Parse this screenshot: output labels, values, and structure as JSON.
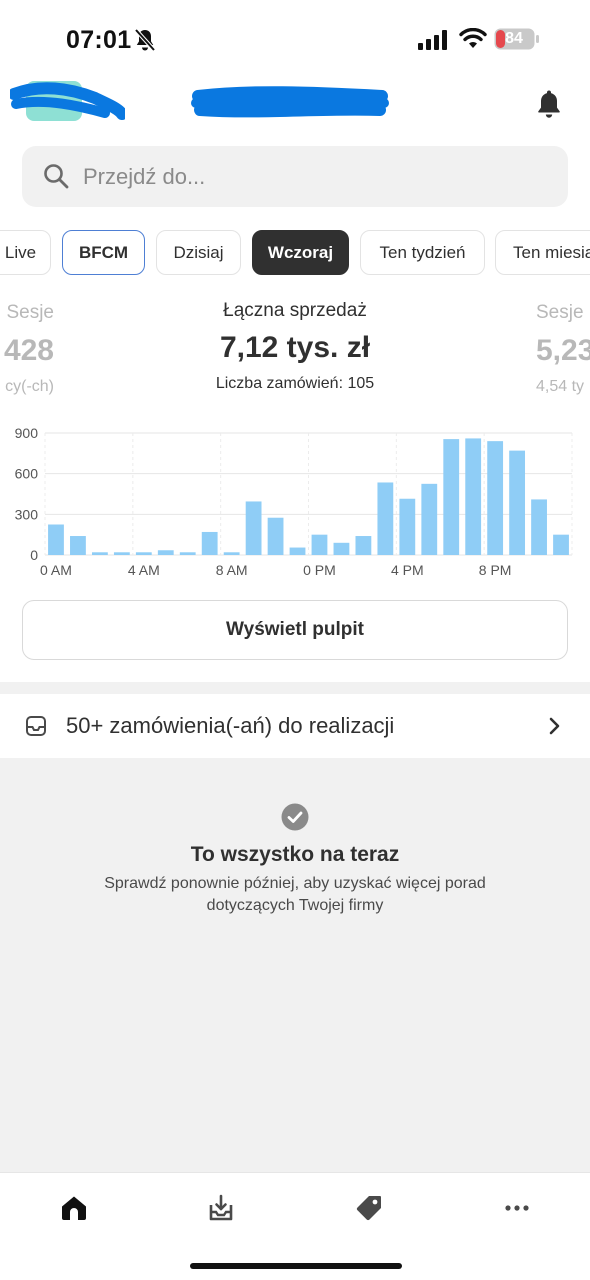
{
  "status": {
    "time": "07:01",
    "battery": "84"
  },
  "search": {
    "placeholder": "Przejdź do..."
  },
  "tabs": [
    {
      "label": "Live"
    },
    {
      "label": "BFCM"
    },
    {
      "label": "Dzisiaj"
    },
    {
      "label": "Wczoraj"
    },
    {
      "label": "Ten tydzień"
    },
    {
      "label": "Ten miesiąc"
    }
  ],
  "metrics": {
    "left": {
      "label": "Sesje",
      "value": "428",
      "sub": "cy(-ch)"
    },
    "main": {
      "label": "Łączna sprzedaż",
      "value": "7,12 tys. zł",
      "sub": "Liczba zamówień: 105"
    },
    "right": {
      "label": "Sesje",
      "value": "5,23",
      "sub": "4,54 ty"
    }
  },
  "chart_data": {
    "type": "bar",
    "categories": [
      "0",
      "1",
      "2",
      "3",
      "4",
      "5",
      "6",
      "7",
      "8",
      "9",
      "10",
      "11",
      "12",
      "13",
      "14",
      "15",
      "16",
      "17",
      "18",
      "19",
      "20",
      "21",
      "22",
      "23"
    ],
    "values": [
      225,
      140,
      20,
      20,
      20,
      35,
      20,
      170,
      20,
      395,
      275,
      55,
      150,
      90,
      140,
      535,
      415,
      525,
      855,
      860,
      840,
      770,
      410,
      150
    ],
    "x_tick_labels": [
      "0 AM",
      "4 AM",
      "8 AM",
      "0 PM",
      "4 PM",
      "8 PM"
    ],
    "y_ticks": [
      0,
      300,
      600,
      900
    ],
    "ylim": [
      0,
      900
    ],
    "bar_color": "#8fcdf6",
    "grid": true
  },
  "dashboard_button": "Wyświetl pulpit",
  "orders": {
    "text": "50+ zamówienia(-ań) do realizacji"
  },
  "empty": {
    "title": "To wszystko na teraz",
    "subtitle": "Sprawdź ponownie później, aby uzyskać więcej porad dotyczących Twojej firmy"
  },
  "nav": [
    "home-icon",
    "orders-icon",
    "products-icon",
    "more-icon"
  ],
  "colors": {
    "active_tab": "#303030",
    "bfcm_border": "#4e7fd4",
    "scribble": "#0a78e0"
  }
}
